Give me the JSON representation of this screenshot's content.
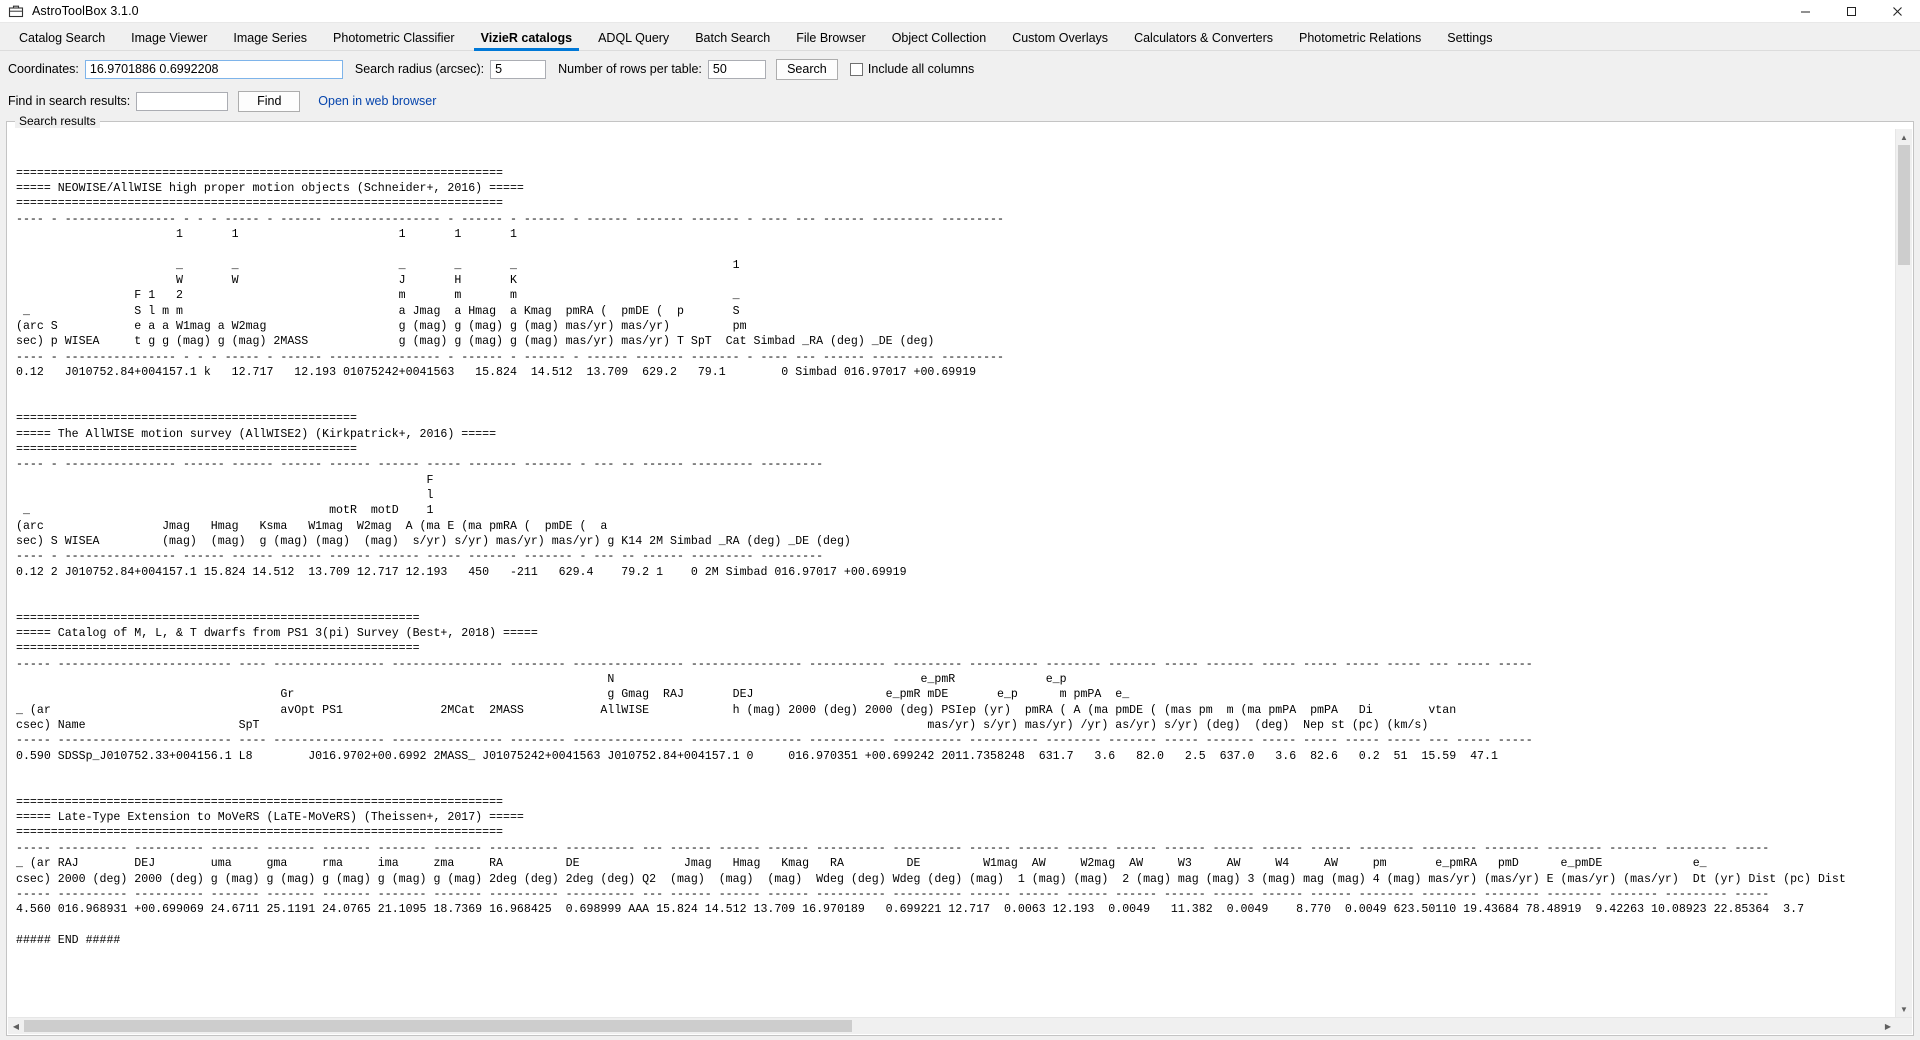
{
  "window": {
    "title": "AstroToolBox 3.1.0",
    "icon": "toolbox-icon",
    "minimize_label": "—",
    "maximize_label": "❐",
    "close_label": "✕"
  },
  "tabs": [
    {
      "label": "Catalog Search",
      "active": false
    },
    {
      "label": "Image Viewer",
      "active": false
    },
    {
      "label": "Image Series",
      "active": false
    },
    {
      "label": "Photometric Classifier",
      "active": false
    },
    {
      "label": "VizieR catalogs",
      "active": true
    },
    {
      "label": "ADQL Query",
      "active": false
    },
    {
      "label": "Batch Search",
      "active": false
    },
    {
      "label": "File Browser",
      "active": false
    },
    {
      "label": "Object Collection",
      "active": false
    },
    {
      "label": "Custom Overlays",
      "active": false
    },
    {
      "label": "Calculators & Converters",
      "active": false
    },
    {
      "label": "Photometric Relations",
      "active": false
    },
    {
      "label": "Settings",
      "active": false
    }
  ],
  "search_form": {
    "coordinates_label": "Coordinates:",
    "coordinates_value": "16.9701886 0.6992208",
    "radius_label": "Search radius (arcsec):",
    "radius_value": "5",
    "rows_label": "Number of rows per table:",
    "rows_value": "50",
    "search_button": "Search",
    "include_all_columns_label": "Include all columns",
    "include_all_columns_checked": false,
    "find_label": "Find in search results:",
    "find_value": "",
    "find_button": "Find",
    "open_web_link": "Open in web browser"
  },
  "results": {
    "legend": "Search results",
    "text": "\n\n======================================================================\n===== NEOWISE/AllWISE high proper motion objects (Schneider+, 2016) =====\n======================================================================\n---- - ---------------- - - - ----- - ------ ---------------- - ------ - ------ - ------ ------- ------- - ---- --- ------ --------- ---------\n                       1       1                       1       1       1\n\n                       _       _                       _       _       _                               1\n                       W       W                       J       H       K\n                 F 1   2                               m       m       m                               _\n _               S l m m                               a Jmag  a Hmag  a Kmag  pmRA (  pmDE (  p       S\n(arc S           e a a W1mag a W2mag                   g (mag) g (mag) g (mag) mas/yr) mas/yr)         pm\nsec) p WISEA     t g g (mag) g (mag) 2MASS             g (mag) g (mag) g (mag) mas/yr) mas/yr) T SpT  Cat Simbad _RA (deg) _DE (deg)\n---- - ---------------- - - - ----- - ------ ---------------- - ------ - ------ - ------ ------- ------- - ---- --- ------ --------- ---------\n0.12   J010752.84+004157.1 k   12.717   12.193 01075242+0041563   15.824  14.512  13.709  629.2   79.1        0 Simbad 016.97017 +00.69919\n\n\n=================================================\n===== The AllWISE motion survey (AllWISE2) (Kirkpatrick+, 2016) =====\n=================================================\n---- - ---------------- ------ ------ ------ ------ ------ ----- ------- ------- - --- -- ------ --------- ---------\n                                                           F\n                                                           l\n _                                           motR  motD    1\n(arc                 Jmag   Hmag   Ksma   W1mag  W2mag  A (ma E (ma pmRA (  pmDE (  a\nsec) S WISEA         (mag)  (mag)  g (mag) (mag)  (mag)  s/yr) s/yr) mas/yr) mas/yr) g K14 2M Simbad _RA (deg) _DE (deg)\n---- - ---------------- ------ ------ ------ ------ ------ ----- ------- ------- - --- -- ------ --------- ---------\n0.12 2 J010752.84+004157.1 15.824 14.512  13.709 12.717 12.193   450   -211   629.4    79.2 1    0 2M Simbad 016.97017 +00.69919\n\n\n==========================================================\n===== Catalog of M, L, & T dwarfs from PS1 3(pi) Survey (Best+, 2018) =====\n==========================================================\n----- ------------------------- ---- ---------------- ---------------- -------- ---------------- ---------------- ----------- ---------- ---------- -------- ------- ----- ------- ----- ----- ----- ----- --- ----- -----\n                                                                                     N                                            e_pmR             e_p\n                                      Gr                                             g Gmag  RAJ       DEJ                   e_pmR mDE       e_p      m pmPA  e_\n_ (ar                                 avOpt PS1              2MCat  2MASS           AllWISE            h (mag) 2000 (deg) 2000 (deg) PSIep (yr)  pmRA ( A (ma pmDE ( (mas pm  m (ma pmPA  pmPA   Di        vtan\ncsec) Name                      SpT                                                                                                mas/yr) s/yr) mas/yr) /yr) as/yr) s/yr) (deg)  (deg)  Nep st (pc) (km/s)\n----- ------------------------- ---- ---------------- ---------------- -------- ---------------- ---------------- ----------- ---------- ---------- -------- ------- ----- ------- ----- ----- ----- ----- --- ----- -----\n0.590 SDSSp_J010752.33+004156.1 L8        J016.9702+00.6992 2MASS_ J01075242+0041563 J010752.84+004157.1 0     016.970351 +00.699242 2011.7358248  631.7   3.6   82.0   2.5  637.0   3.6  82.6   0.2  51  15.59  47.1\n\n\n======================================================================\n===== Late-Type Extension to MoVeRS (LaTE-MoVeRS) (Theissen+, 2017) =====\n======================================================================\n----- ---------- ---------- ------- ------- ------- ------- ------- ---------- ---------- --- ------ ------ ------ ---------- ---------- ------ ------ ------ ------ ------ ------ ------ ------ -------- -------- -------- -------- ------- --------- -----\n_ (ar RAJ        DEJ        uma     gma     rma     ima     zma     RA         DE               Jmag   Hmag   Kmag   RA         DE         W1mag  AW     W2mag  AW     W3     AW     W4     AW     pm       e_pmRA   pmD      e_pmDE             e_\ncsec) 2000 (deg) 2000 (deg) g (mag) g (mag) g (mag) g (mag) g (mag) 2deg (deg) 2deg (deg) Q2  (mag)  (mag)  (mag)  Wdeg (deg) Wdeg (deg) (mag)  1 (mag) (mag)  2 (mag) mag (mag) 3 (mag) mag (mag) 4 (mag) mas/yr) (mas/yr) E (mas/yr) (mas/yr)  Dt (yr) Dist (pc) Dist\n----- ---------- ---------- ------- ------- ------- ------- ------- ---------- ---------- --- ------ ------ ------ ---------- ---------- ------ ------ ------ ------ ------ ------ ------ ------ -------- -------- -------- -------- ------- --------- -----\n4.560 016.968931 +00.699069 24.6711 25.1191 24.0765 21.1095 18.7369 16.968425  0.698999 AAA 15.824 14.512 13.709 16.970189   0.699221 12.717  0.0063 12.193  0.0049   11.382  0.0049    8.770  0.0049 623.50110 19.43684 78.48919  9.42263 10.08923 22.85364  3.7\n\n##### END #####",
    "scrollbar": {
      "vertical_up": "▲",
      "vertical_down": "▼",
      "horizontal_left": "◀",
      "horizontal_right": "▶"
    }
  }
}
